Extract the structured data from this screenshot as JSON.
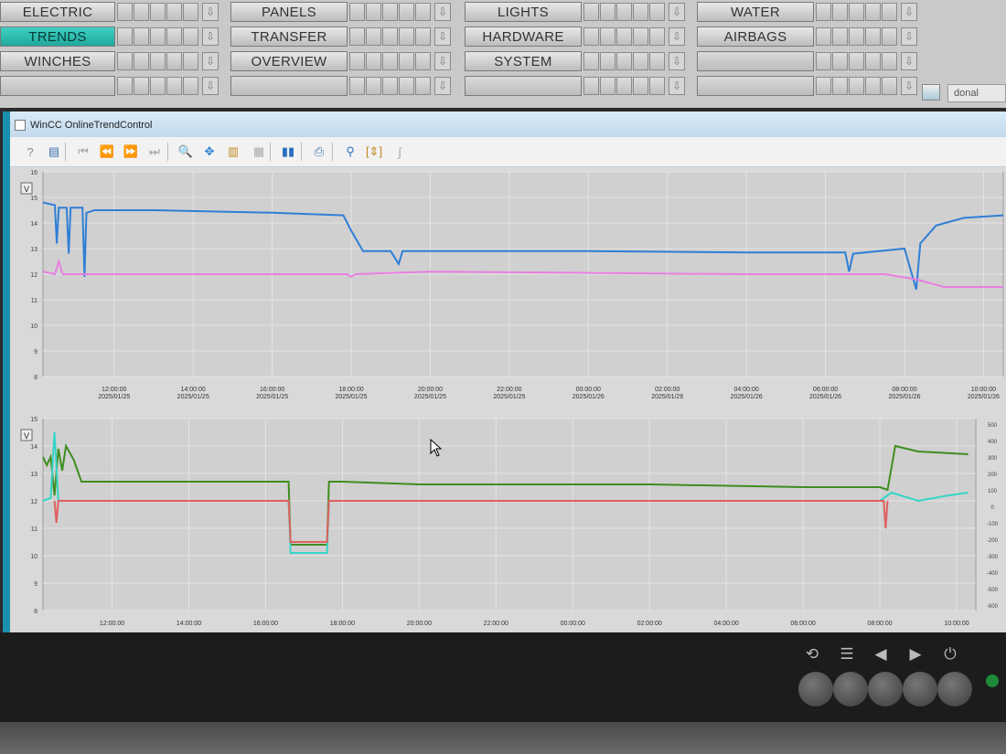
{
  "nav": {
    "groups": [
      {
        "buttons": [
          "ELECTRIC",
          "TRENDS",
          "WINCHES",
          ""
        ],
        "active": 1
      },
      {
        "buttons": [
          "PANELS",
          "TRANSFER",
          "OVERVIEW",
          ""
        ],
        "active": -1
      },
      {
        "buttons": [
          "LIGHTS",
          "HARDWARE",
          "SYSTEM",
          ""
        ],
        "active": -1
      },
      {
        "buttons": [
          "WATER",
          "AIRBAGS",
          "",
          ""
        ],
        "active": -1
      }
    ],
    "user": "donal"
  },
  "window": {
    "title": "WinCC OnlineTrendControl"
  },
  "toolbar": {
    "icons": [
      "help-icon",
      "config-icon",
      "first-icon",
      "prev-icon",
      "next-icon",
      "last-icon",
      "zoom-icon",
      "move-icon",
      "scale-icon",
      "original-view-icon",
      "stop-icon",
      "print-icon",
      "ruler-icon",
      "select-range-icon",
      "statistics-icon"
    ]
  },
  "chart_data": [
    {
      "type": "line",
      "y_axis_unit": "V",
      "ylim": [
        8,
        16
      ],
      "y_ticks": [
        16,
        15,
        14,
        13,
        12,
        11,
        10,
        9,
        8
      ],
      "x_ticks": [
        {
          "time": "12:00:00",
          "date": "2025/01/25"
        },
        {
          "time": "14:00:00",
          "date": "2025/01/25"
        },
        {
          "time": "16:00:00",
          "date": "2025/01/25"
        },
        {
          "time": "18:00:00",
          "date": "2025/01/25"
        },
        {
          "time": "20:00:00",
          "date": "2025/01/25"
        },
        {
          "time": "22:00:00",
          "date": "2025/01/25"
        },
        {
          "time": "00:00:00",
          "date": "2025/01/26"
        },
        {
          "time": "02:00:00",
          "date": "2025/01/26"
        },
        {
          "time": "04:00:00",
          "date": "2025/01/26"
        },
        {
          "time": "06:00:00",
          "date": "2025/01/26"
        },
        {
          "time": "08:00:00",
          "date": "2025/01/26"
        },
        {
          "time": "10:00:00",
          "date": "2025/01/26"
        }
      ],
      "x_range_hours": [
        10.2,
        10.3
      ],
      "series": [
        {
          "color": "#2f7fd6",
          "points": [
            [
              10.2,
              14.8
            ],
            [
              10.5,
              14.7
            ],
            [
              10.55,
              13.2
            ],
            [
              10.6,
              14.6
            ],
            [
              10.8,
              14.6
            ],
            [
              10.85,
              12.8
            ],
            [
              10.9,
              14.6
            ],
            [
              11.2,
              14.6
            ],
            [
              11.25,
              11.9
            ],
            [
              11.3,
              14.4
            ],
            [
              11.5,
              14.5
            ],
            [
              13,
              14.5
            ],
            [
              16,
              14.4
            ],
            [
              17.8,
              14.3
            ],
            [
              18,
              13.7
            ],
            [
              18.3,
              12.9
            ],
            [
              19,
              12.9
            ],
            [
              19.2,
              12.4
            ],
            [
              19.3,
              12.9
            ],
            [
              22,
              12.9
            ],
            [
              24,
              12.9
            ],
            [
              28,
              12.85
            ],
            [
              30.5,
              12.85
            ],
            [
              30.6,
              12.1
            ],
            [
              30.7,
              12.8
            ],
            [
              32,
              13.0
            ],
            [
              32.3,
              11.4
            ],
            [
              32.4,
              13.2
            ],
            [
              32.8,
              13.9
            ],
            [
              33.5,
              14.2
            ],
            [
              34.5,
              14.3
            ]
          ]
        },
        {
          "color": "#e87fe0",
          "points": [
            [
              10.2,
              12.1
            ],
            [
              10.5,
              12.0
            ],
            [
              10.6,
              12.5
            ],
            [
              10.7,
              12.0
            ],
            [
              11.3,
              12.0
            ],
            [
              16,
              12.0
            ],
            [
              17.9,
              12.0
            ],
            [
              18,
              11.9
            ],
            [
              18.1,
              12.0
            ],
            [
              20,
              12.1
            ],
            [
              24,
              12.05
            ],
            [
              28,
              12.0
            ],
            [
              31.5,
              12.0
            ],
            [
              32.3,
              11.8
            ],
            [
              33,
              11.5
            ],
            [
              34.5,
              11.5
            ]
          ]
        }
      ]
    },
    {
      "type": "line",
      "y_axis_unit": "V",
      "ylim": [
        8,
        15
      ],
      "y_ticks": [
        15,
        14,
        13,
        12,
        11,
        10,
        9,
        8
      ],
      "right_y_ticks": [
        500,
        400,
        300,
        200,
        100,
        0,
        -100,
        -200,
        -300,
        -400,
        -500,
        -600
      ],
      "x_ticks": [
        "12:00:00",
        "14:00:00",
        "16:00:00",
        "18:00:00",
        "20:00:00",
        "22:00:00",
        "00:00:00",
        "02:00:00",
        "04:00:00",
        "06:00:00",
        "08:00:00",
        "10:00:00"
      ],
      "series": [
        {
          "color": "#3e8e20",
          "points": [
            [
              10.2,
              13.6
            ],
            [
              10.3,
              13.3
            ],
            [
              10.4,
              13.6
            ],
            [
              10.5,
              12.2
            ],
            [
              10.6,
              13.9
            ],
            [
              10.7,
              13.1
            ],
            [
              10.8,
              14.0
            ],
            [
              11.0,
              13.5
            ],
            [
              11.2,
              12.7
            ],
            [
              13,
              12.7
            ],
            [
              16.6,
              12.7
            ],
            [
              16.65,
              10.4
            ],
            [
              17.6,
              10.4
            ],
            [
              17.65,
              12.7
            ],
            [
              18,
              12.7
            ],
            [
              20,
              12.6
            ],
            [
              26,
              12.6
            ],
            [
              30,
              12.5
            ],
            [
              32.0,
              12.5
            ],
            [
              32.2,
              12.4
            ],
            [
              32.4,
              14.0
            ],
            [
              33,
              13.8
            ],
            [
              34.3,
              13.7
            ]
          ]
        },
        {
          "color": "#35d6c8",
          "points": [
            [
              10.2,
              12.0
            ],
            [
              10.4,
              12.1
            ],
            [
              10.5,
              14.5
            ],
            [
              10.6,
              12.0
            ],
            [
              11,
              12.0
            ],
            [
              16.6,
              12.0
            ],
            [
              16.65,
              10.1
            ],
            [
              17.6,
              10.1
            ],
            [
              17.65,
              12.0
            ],
            [
              26,
              12.0
            ],
            [
              32,
              12.0
            ],
            [
              32.3,
              12.3
            ],
            [
              33,
              12.0
            ],
            [
              33.8,
              12.2
            ],
            [
              34.3,
              12.3
            ]
          ]
        },
        {
          "color": "#e06060",
          "points": [
            [
              10.5,
              12.0
            ],
            [
              10.55,
              11.2
            ],
            [
              10.6,
              12.0
            ],
            [
              16.6,
              12.0
            ],
            [
              16.65,
              10.5
            ],
            [
              17.6,
              10.5
            ],
            [
              17.65,
              12.0
            ],
            [
              32.1,
              12.0
            ],
            [
              32.15,
              11.0
            ],
            [
              32.2,
              12.0
            ]
          ]
        }
      ]
    }
  ]
}
